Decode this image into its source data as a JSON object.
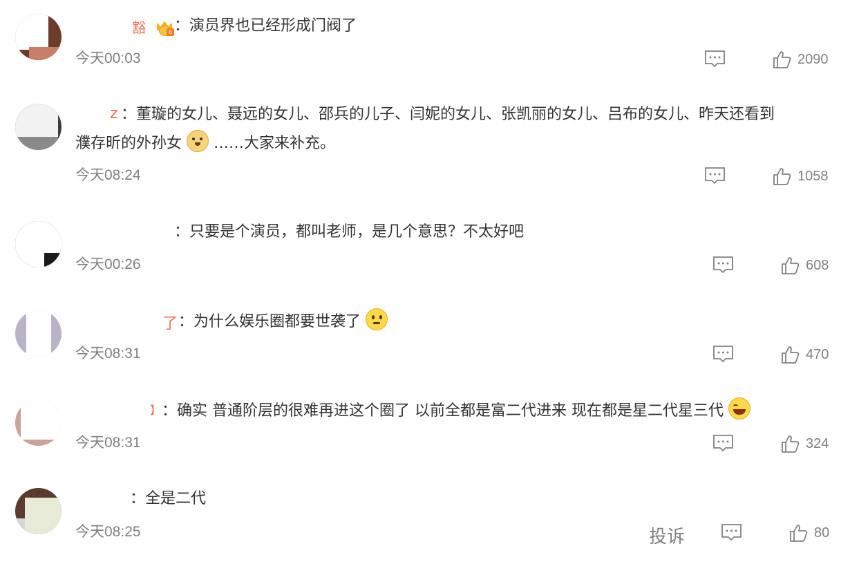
{
  "icons": {
    "reply": "comment-bubble-icon",
    "like": "thumbs-up-icon"
  },
  "colors": {
    "username": "#eb7350",
    "text": "#333333",
    "meta": "#808080"
  },
  "comments": [
    {
      "name": "豁",
      "badge": "crown-level-badge",
      "badge_level": "6",
      "text": "：演员界也已经形成门阀了",
      "time": "今天00:03",
      "likes": "2090"
    },
    {
      "name": "z",
      "text_line1": "：董璇的女儿、聂远的女儿、邵兵的儿子、闫妮的女儿、张凯丽的女儿、吕布的女儿、昨天还看到",
      "text_line2a": "濮存昕的外孙女",
      "emoji": "doge-emoji",
      "text_line2b": "……大家来补充。",
      "time": "今天08:24",
      "likes": "1058"
    },
    {
      "name": "",
      "text": "：只要是个演员，都叫老师，是几个意思？不太好吧",
      "time": "今天00:26",
      "likes": "608"
    },
    {
      "name": "了",
      "text": "：为什么娱乐圈都要世袭了",
      "emoji": "thinking-emoji",
      "time": "今天08:31",
      "likes": "470"
    },
    {
      "name": "】",
      "text": "：确实 普通阶层的很难再进这个圈了 以前全都是富二代进来 现在都是星二代星三代",
      "emoji": "laughing-tears-emoji",
      "time": "今天08:31",
      "likes": "324"
    },
    {
      "name": "",
      "text": "：全是二代",
      "time": "今天08:25",
      "report": "投诉",
      "likes": "80"
    }
  ]
}
